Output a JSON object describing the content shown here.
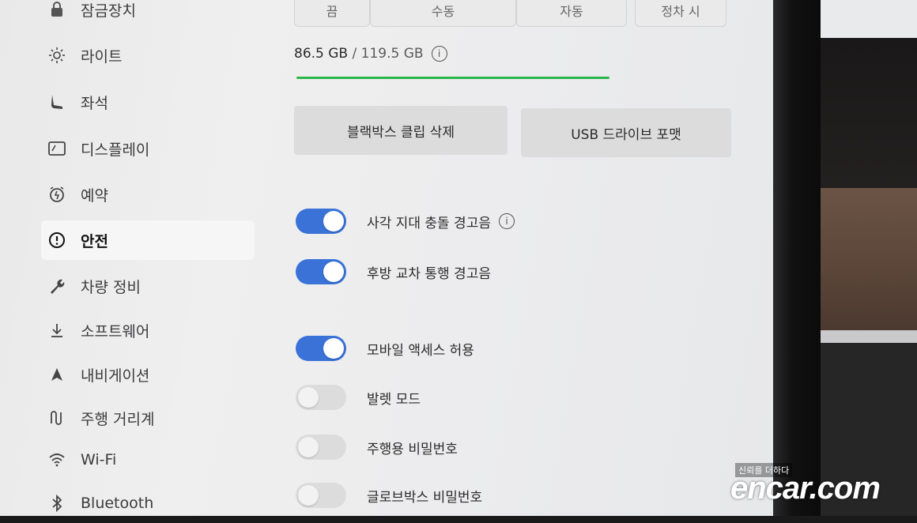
{
  "sidebar": {
    "items": [
      {
        "label": "잠금장치",
        "icon": "lock-icon"
      },
      {
        "label": "라이트",
        "icon": "light-icon"
      },
      {
        "label": "좌석",
        "icon": "seat-icon"
      },
      {
        "label": "디스플레이",
        "icon": "display-icon"
      },
      {
        "label": "예약",
        "icon": "schedule-icon"
      },
      {
        "label": "안전",
        "icon": "safety-icon",
        "active": true
      },
      {
        "label": "차량 정비",
        "icon": "wrench-icon"
      },
      {
        "label": "소프트웨어",
        "icon": "download-icon"
      },
      {
        "label": "내비게이션",
        "icon": "navigation-icon"
      },
      {
        "label": "주행 거리계",
        "icon": "trip-icon"
      },
      {
        "label": "Wi-Fi",
        "icon": "wifi-icon"
      },
      {
        "label": "Bluetooth",
        "icon": "bluetooth-icon"
      }
    ]
  },
  "tabs": [
    "끔",
    "수동",
    "자동",
    "정차 시"
  ],
  "storage": {
    "used": "86.5 GB",
    "separator": " / ",
    "total": "119.5 GB",
    "used_fraction": 0.724
  },
  "actions": {
    "delete_clips": "블랙박스 클립 삭제",
    "format_usb": "USB 드라이브 포맷"
  },
  "toggles": [
    {
      "label": "사각 지대 충돌 경고음",
      "on": true,
      "info": true
    },
    {
      "label": "후방 교차 통행 경고음",
      "on": true,
      "info": false
    },
    {
      "label": "모바일 액세스 허용",
      "on": true,
      "info": false
    },
    {
      "label": "발렛 모드",
      "on": false,
      "info": false
    },
    {
      "label": "주행용 비밀번호",
      "on": false,
      "info": false
    },
    {
      "label": "글로브박스 비밀번호",
      "on": false,
      "info": false
    }
  ],
  "watermark": {
    "tagline": "신뢰를 더하다",
    "brand": "encar.com"
  },
  "colors": {
    "toggle_on": "#3a72d8",
    "storage_bar": "#2bb64a"
  }
}
